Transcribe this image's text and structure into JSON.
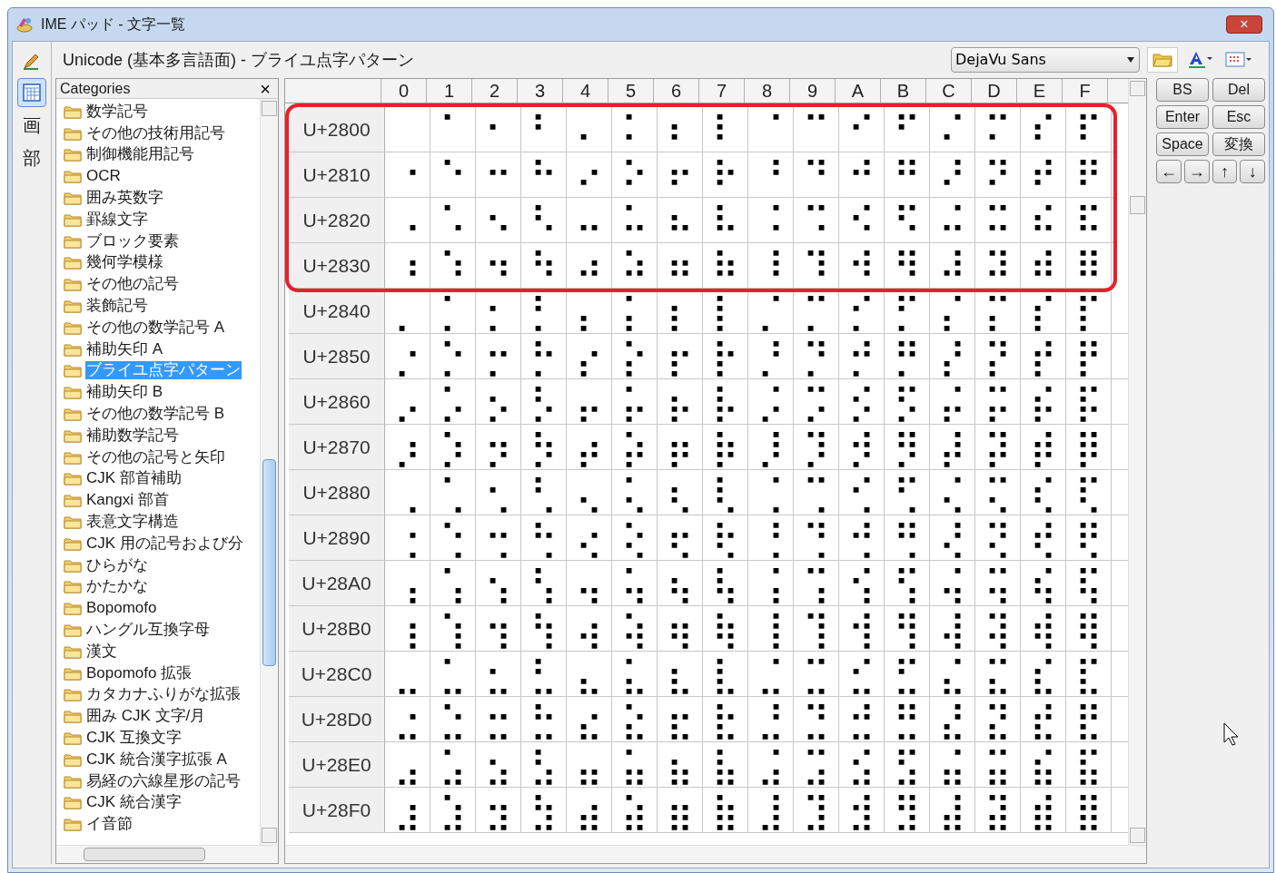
{
  "window": {
    "title": "IME パッド - 文字一覧",
    "close": "×"
  },
  "tools": [
    {
      "kind": "pen",
      "selected": false
    },
    {
      "kind": "charlist",
      "selected": true
    },
    {
      "kind": "text",
      "label": "画",
      "selected": false
    },
    {
      "kind": "text",
      "label": "部",
      "selected": false
    }
  ],
  "path": "Unicode (基本多言語面) - ブライユ点字パターン",
  "font_select": {
    "value": "DejaVu Sans"
  },
  "categories": {
    "title": "Categories",
    "close": "×",
    "items": [
      {
        "name": "数学記号",
        "selected": false
      },
      {
        "name": "その他の技術用記号",
        "selected": false
      },
      {
        "name": "制御機能用記号",
        "selected": false
      },
      {
        "name": "OCR",
        "selected": false
      },
      {
        "name": "囲み英数字",
        "selected": false
      },
      {
        "name": "罫線文字",
        "selected": false
      },
      {
        "name": "ブロック要素",
        "selected": false
      },
      {
        "name": "幾何学模様",
        "selected": false
      },
      {
        "name": "その他の記号",
        "selected": false
      },
      {
        "name": "装飾記号",
        "selected": false
      },
      {
        "name": "その他の数学記号 A",
        "selected": false
      },
      {
        "name": "補助矢印 A",
        "selected": false
      },
      {
        "name": "ブライユ点字パターン",
        "selected": true
      },
      {
        "name": "補助矢印 B",
        "selected": false
      },
      {
        "name": "その他の数学記号 B",
        "selected": false
      },
      {
        "name": "補助数学記号",
        "selected": false
      },
      {
        "name": "その他の記号と矢印",
        "selected": false
      },
      {
        "name": "CJK 部首補助",
        "selected": false
      },
      {
        "name": "Kangxi 部首",
        "selected": false
      },
      {
        "name": "表意文字構造",
        "selected": false
      },
      {
        "name": "CJK 用の記号および分",
        "selected": false
      },
      {
        "name": "ひらがな",
        "selected": false
      },
      {
        "name": "かたかな",
        "selected": false
      },
      {
        "name": "Bopomofo",
        "selected": false
      },
      {
        "name": "ハングル互換字母",
        "selected": false
      },
      {
        "name": "漢文",
        "selected": false
      },
      {
        "name": "Bopomofo 拡張",
        "selected": false
      },
      {
        "name": "カタカナふりがな拡張",
        "selected": false
      },
      {
        "name": "囲み CJK 文字/月",
        "selected": false
      },
      {
        "name": "CJK 互換文字",
        "selected": false
      },
      {
        "name": "CJK 統合漢字拡張 A",
        "selected": false
      },
      {
        "name": "易経の六線星形の記号",
        "selected": false
      },
      {
        "name": "CJK 統合漢字",
        "selected": false
      },
      {
        "name": "イ音節",
        "selected": false
      }
    ]
  },
  "grid": {
    "columns": [
      "0",
      "1",
      "2",
      "3",
      "4",
      "5",
      "6",
      "7",
      "8",
      "9",
      "A",
      "B",
      "C",
      "D",
      "E",
      "F"
    ],
    "rows": [
      {
        "label": "U+2800",
        "highlighted": true,
        "cells": [
          null,
          "⠁",
          "⠂",
          "⠃",
          "⠄",
          "⠅",
          "⠆",
          "⠇",
          "⠈",
          "⠉",
          "⠊",
          "⠋",
          "⠌",
          "⠍",
          "⠎",
          "⠏"
        ]
      },
      {
        "label": "U+2810",
        "highlighted": true,
        "cells": [
          "⠐",
          "⠑",
          "⠒",
          "⠓",
          "⠔",
          "⠕",
          "⠖",
          "⠗",
          "⠘",
          "⠙",
          "⠚",
          "⠛",
          "⠜",
          "⠝",
          "⠞",
          "⠟"
        ]
      },
      {
        "label": "U+2820",
        "highlighted": true,
        "cells": [
          "⠠",
          "⠡",
          "⠢",
          "⠣",
          "⠤",
          "⠥",
          "⠦",
          "⠧",
          "⠨",
          "⠩",
          "⠪",
          "⠫",
          "⠬",
          "⠭",
          "⠮",
          "⠯"
        ]
      },
      {
        "label": "U+2830",
        "highlighted": true,
        "cells": [
          "⠰",
          "⠱",
          "⠲",
          "⠳",
          "⠴",
          "⠵",
          "⠶",
          "⠷",
          "⠸",
          "⠹",
          "⠺",
          "⠻",
          "⠼",
          "⠽",
          "⠾",
          "⠿"
        ]
      },
      {
        "label": "U+2840",
        "highlighted": false,
        "cells": [
          "⡀",
          "⡁",
          "⡂",
          "⡃",
          "⡄",
          "⡅",
          "⡆",
          "⡇",
          "⡈",
          "⡉",
          "⡊",
          "⡋",
          "⡌",
          "⡍",
          "⡎",
          "⡏"
        ]
      },
      {
        "label": "U+2850",
        "highlighted": false,
        "cells": [
          "⡐",
          "⡑",
          "⡒",
          "⡓",
          "⡔",
          "⡕",
          "⡖",
          "⡗",
          "⡘",
          "⡙",
          "⡚",
          "⡛",
          "⡜",
          "⡝",
          "⡞",
          "⡟"
        ]
      },
      {
        "label": "U+2860",
        "highlighted": false,
        "cells": [
          "⡠",
          "⡡",
          "⡢",
          "⡣",
          "⡤",
          "⡥",
          "⡦",
          "⡧",
          "⡨",
          "⡩",
          "⡪",
          "⡫",
          "⡬",
          "⡭",
          "⡮",
          "⡯"
        ]
      },
      {
        "label": "U+2870",
        "highlighted": false,
        "cells": [
          "⡰",
          "⡱",
          "⡲",
          "⡳",
          "⡴",
          "⡵",
          "⡶",
          "⡷",
          "⡸",
          "⡹",
          "⡺",
          "⡻",
          "⡼",
          "⡽",
          "⡾",
          "⡿"
        ]
      },
      {
        "label": "U+2880",
        "highlighted": false,
        "cells": [
          "⢀",
          "⢁",
          "⢂",
          "⢃",
          "⢄",
          "⢅",
          "⢆",
          "⢇",
          "⢈",
          "⢉",
          "⢊",
          "⢋",
          "⢌",
          "⢍",
          "⢎",
          "⢏"
        ]
      },
      {
        "label": "U+2890",
        "highlighted": false,
        "cells": [
          "⢐",
          "⢑",
          "⢒",
          "⢓",
          "⢔",
          "⢕",
          "⢖",
          "⢗",
          "⢘",
          "⢙",
          "⢚",
          "⢛",
          "⢜",
          "⢝",
          "⢞",
          "⢟"
        ]
      },
      {
        "label": "U+28A0",
        "highlighted": false,
        "cells": [
          "⢠",
          "⢡",
          "⢢",
          "⢣",
          "⢤",
          "⢥",
          "⢦",
          "⢧",
          "⢨",
          "⢩",
          "⢪",
          "⢫",
          "⢬",
          "⢭",
          "⢮",
          "⢯"
        ]
      },
      {
        "label": "U+28B0",
        "highlighted": false,
        "cells": [
          "⢰",
          "⢱",
          "⢲",
          "⢳",
          "⢴",
          "⢵",
          "⢶",
          "⢷",
          "⢸",
          "⢹",
          "⢺",
          "⢻",
          "⢼",
          "⢽",
          "⢾",
          "⢿"
        ]
      },
      {
        "label": "U+28C0",
        "highlighted": false,
        "cells": [
          "⣀",
          "⣁",
          "⣂",
          "⣃",
          "⣄",
          "⣅",
          "⣆",
          "⣇",
          "⣈",
          "⣉",
          "⣊",
          "⣋",
          "⣌",
          "⣍",
          "⣎",
          "⣏"
        ]
      },
      {
        "label": "U+28D0",
        "highlighted": false,
        "cells": [
          "⣐",
          "⣑",
          "⣒",
          "⣓",
          "⣔",
          "⣕",
          "⣖",
          "⣗",
          "⣘",
          "⣙",
          "⣚",
          "⣛",
          "⣜",
          "⣝",
          "⣞",
          "⣟"
        ]
      },
      {
        "label": "U+28E0",
        "highlighted": false,
        "cells": [
          "⣠",
          "⣡",
          "⣢",
          "⣣",
          "⣤",
          "⣥",
          "⣦",
          "⣧",
          "⣨",
          "⣩",
          "⣪",
          "⣫",
          "⣬",
          "⣭",
          "⣮",
          "⣯"
        ]
      },
      {
        "label": "U+28F0",
        "highlighted": false,
        "cells": [
          "⣰",
          "⣱",
          "⣲",
          "⣳",
          "⣴",
          "⣵",
          "⣶",
          "⣷",
          "⣸",
          "⣹",
          "⣺",
          "⣻",
          "⣼",
          "⣽",
          "⣾",
          "⣿"
        ]
      }
    ]
  },
  "keys": [
    "BS",
    "Del",
    "Enter",
    "Esc",
    "Space",
    "変換",
    "←",
    "→",
    "↑",
    "↓"
  ]
}
